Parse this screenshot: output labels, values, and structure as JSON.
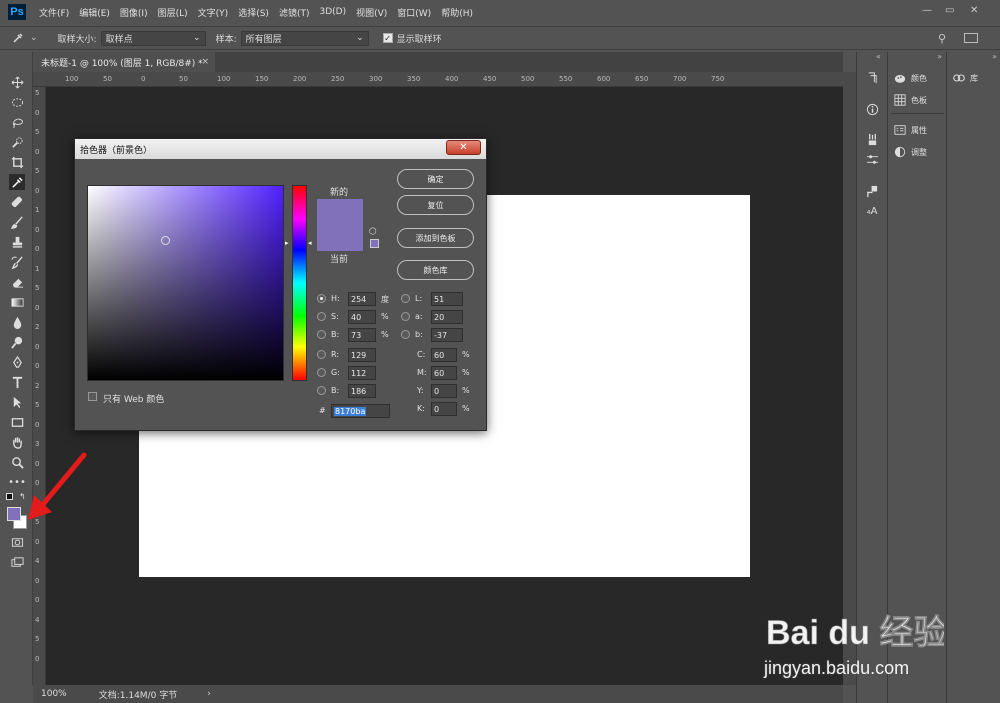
{
  "menubar": {
    "logo": "Ps",
    "items": [
      "文件(F)",
      "编辑(E)",
      "图像(I)",
      "图层(L)",
      "文字(Y)",
      "选择(S)",
      "滤镜(T)",
      "3D(D)",
      "视图(V)",
      "窗口(W)",
      "帮助(H)"
    ]
  },
  "options": {
    "sample_size_label": "取样大小:",
    "sample_size_value": "取样点",
    "sample_label": "样本:",
    "sample_value": "所有图层",
    "show_ring_label": "显示取样环",
    "show_ring_checked": true
  },
  "document": {
    "tab_title": "未标题-1 @ 100% (图层 1, RGB/8#) *",
    "zoom": "100%",
    "doc_info": "文档:1.14M/0 字节"
  },
  "ruler_top": [
    "100",
    "50",
    "0",
    "50",
    "100",
    "150",
    "200",
    "250",
    "300",
    "350",
    "400",
    "450",
    "500",
    "550",
    "600",
    "650",
    "700",
    "750"
  ],
  "ruler_left": [
    "5",
    "0",
    "5",
    "0",
    "5",
    "0",
    "1",
    "0",
    "0",
    "1",
    "5",
    "0",
    "2",
    "0",
    "0",
    "2",
    "5",
    "0",
    "3",
    "0",
    "0",
    "3",
    "5",
    "0",
    "4",
    "0",
    "0",
    "4",
    "5",
    "0"
  ],
  "colors": {
    "foreground": "#8170ba",
    "background": "#ffffff",
    "accent_red": "#e31b1b"
  },
  "panels": {
    "group1": [
      {
        "icon": "color-icon",
        "label": "颜色"
      },
      {
        "icon": "swatches-icon",
        "label": "色板"
      }
    ],
    "group2": [
      {
        "icon": "properties-icon",
        "label": "属性"
      },
      {
        "icon": "adjustments-icon",
        "label": "调整"
      }
    ],
    "group3": [
      {
        "icon": "libraries-icon",
        "label": "库"
      }
    ]
  },
  "color_picker": {
    "title": "拾色器（前景色）",
    "new_label": "新的",
    "current_label": "当前",
    "new_color": "#8170ba",
    "current_color": "#8170ba",
    "buttons": {
      "ok": "确定",
      "reset": "复位",
      "add_swatch": "添加到色板",
      "color_libraries": "颜色库"
    },
    "web_only_label": "只有 Web 颜色",
    "hsb": {
      "h_label": "H:",
      "h": "254",
      "h_unit": "度",
      "s_label": "S:",
      "s": "40",
      "s_unit": "%",
      "b_label": "B:",
      "b": "73",
      "b_unit": "%"
    },
    "lab": {
      "l_label": "L:",
      "l": "51",
      "a_label": "a:",
      "a": "20",
      "b_label": "b:",
      "b": "-37"
    },
    "rgb": {
      "r_label": "R:",
      "r": "129",
      "g_label": "G:",
      "g": "112",
      "b_label": "B:",
      "b": "186"
    },
    "cmyk": {
      "c_label": "C:",
      "c": "60",
      "m_label": "M:",
      "m": "60",
      "y_label": "Y:",
      "y": "0",
      "k_label": "K:",
      "k": "0",
      "unit": "%"
    },
    "hex_label": "#",
    "hex": "8170ba",
    "hue_color": "#5022ff"
  },
  "watermark": {
    "brand": "Bai du 经验",
    "url": "jingyan.baidu.com"
  }
}
